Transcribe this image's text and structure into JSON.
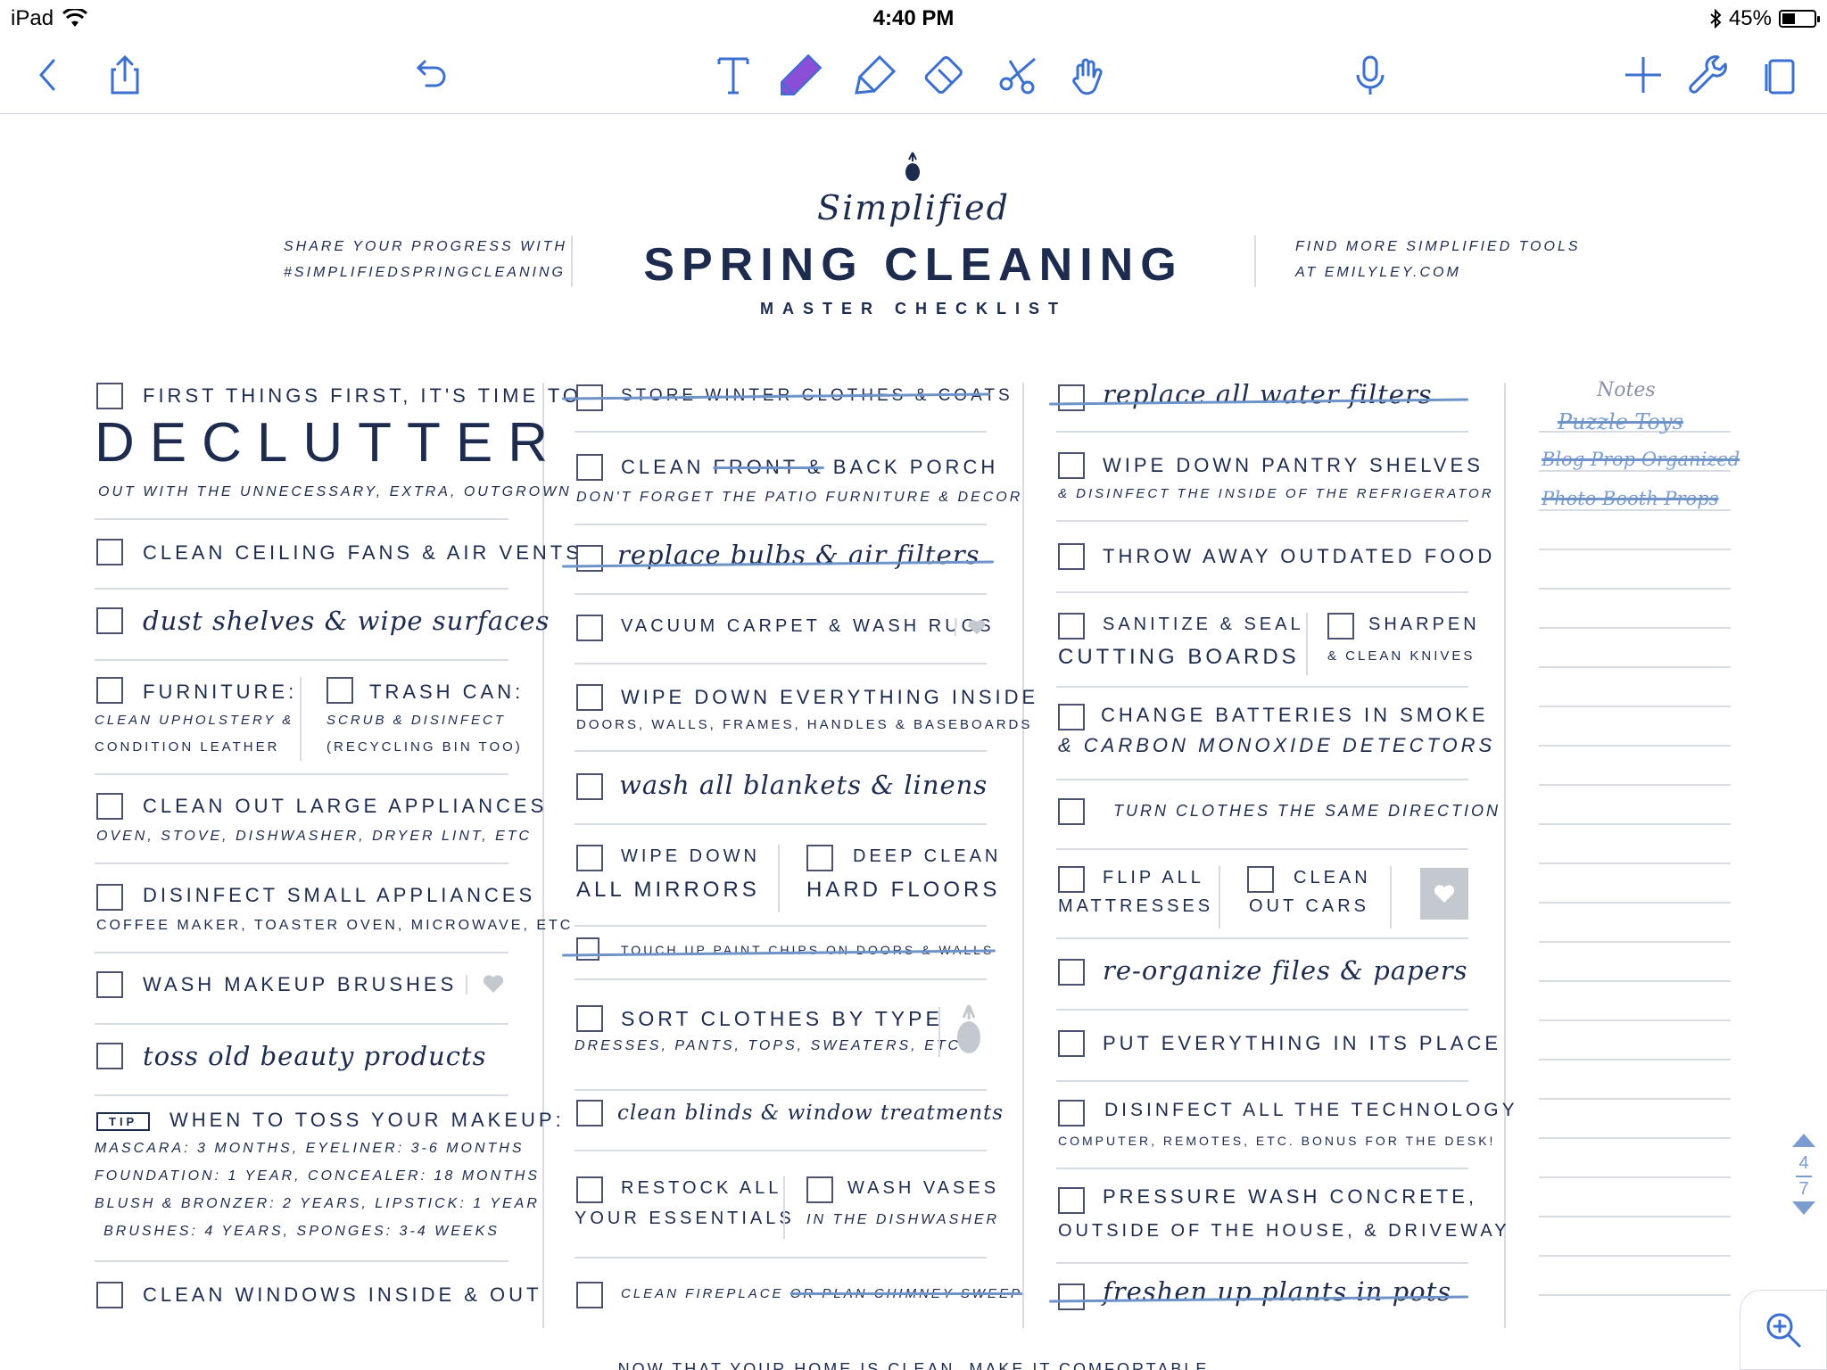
{
  "status": {
    "device": "iPad",
    "time": "4:40 PM",
    "battery": "45%",
    "battery_level": 0.45
  },
  "toolbar": {
    "left_icons": [
      "back-icon",
      "share-icon",
      "undo-icon"
    ],
    "center_icons": [
      "text-tool-icon",
      "pencil-tool-icon",
      "highlighter-tool-icon",
      "eraser-tool-icon",
      "lasso-scissors-icon",
      "hand-tool-icon",
      "microphone-icon"
    ],
    "right_icons": [
      "add-page-icon",
      "wrench-icon",
      "page-view-icon"
    ],
    "selected_tool": "pencil-tool-icon",
    "accent": "#3b6fd1",
    "pencil_color": "#8a4fd6"
  },
  "header": {
    "left_line1": "SHARE YOUR PROGRESS WITH",
    "left_line2": "#SIMPLIFIEDSPRINGCLEANING",
    "script": "Simplified",
    "title": "SPRING CLEANING",
    "subtitle": "MASTER CHECKLIST",
    "right_line1": "FIND MORE SIMPLIFIED TOOLS",
    "right_line2": "AT EMILYLEY.COM"
  },
  "col1": {
    "declutter_pre": "FIRST THINGS FIRST, IT'S TIME TO",
    "declutter_big": "DECLUTTER",
    "declutter_sub": "OUT WITH THE UNNECESSARY, EXTRA, OUTGROWN",
    "fans": "CLEAN CEILING FANS & AIR VENTS",
    "dust": "dust shelves & wipe surfaces",
    "furniture": "FURNITURE:",
    "furniture_sub1": "CLEAN UPHOLSTERY &",
    "furniture_sub2": "CONDITION LEATHER",
    "trash": "TRASH CAN:",
    "trash_sub1": "SCRUB & DISINFECT",
    "trash_sub2": "(RECYCLING BIN TOO)",
    "large_app": "CLEAN OUT LARGE APPLIANCES",
    "large_app_sub": "OVEN, STOVE, DISHWASHER, DRYER LINT, ETC",
    "small_app": "DISINFECT SMALL APPLIANCES",
    "small_app_sub": "COFFEE MAKER, TOASTER OVEN, MICROWAVE, ETC",
    "brushes": "WASH MAKEUP BRUSHES",
    "beauty": "toss old beauty products",
    "tip_badge": "TIP",
    "tip_title": "WHEN TO TOSS YOUR MAKEUP:",
    "tip_lines": [
      "MASCARA: 3 MONTHS, EYELINER: 3-6 MONTHS",
      "FOUNDATION: 1 YEAR, CONCEALER: 18 MONTHS",
      "BLUSH & BRONZER: 2 YEARS, LIPSTICK: 1 YEAR",
      "BRUSHES: 4 YEARS, SPONGES: 3-4 WEEKS"
    ],
    "windows": "CLEAN WINDOWS INSIDE & OUT"
  },
  "col2": {
    "winter": "STORE WINTER CLOTHES & COATS",
    "porch_a": "CLEAN ",
    "porch_b": "FRONT &",
    "porch_c": " BACK PORCH",
    "porch_sub": "DON'T FORGET THE PATIO FURNITURE & DECOR",
    "bulbs": "replace bulbs & air filters",
    "vacuum": "VACUUM CARPET & WASH RUGS",
    "wipe_inside": "WIPE DOWN EVERYTHING INSIDE",
    "wipe_inside_sub": "DOORS, WALLS, FRAMES, HANDLES & BASEBOARDS",
    "blankets": "wash all blankets & linens",
    "mirrors1": "WIPE DOWN",
    "mirrors2": "ALL MIRRORS",
    "floors1": "DEEP CLEAN",
    "floors2": "HARD FLOORS",
    "paint": "TOUCH UP PAINT CHIPS ON DOORS & WALLS",
    "sort": "SORT CLOTHES BY TYPE",
    "sort_sub": "DRESSES, PANTS, TOPS, SWEATERS, ETC",
    "blinds": "clean blinds & window treatments",
    "restock1": "RESTOCK ALL",
    "restock2": "YOUR ESSENTIALS",
    "vases1": "WASH VASES",
    "vases2": "IN THE DISHWASHER",
    "fireplace_a": "CLEAN FIREPLACE ",
    "fireplace_b": "OR PLAN CHIMNEY SWEEP"
  },
  "col3": {
    "water": "replace all water filters",
    "pantry": "WIPE DOWN PANTRY SHELVES",
    "pantry_sub": "& DISINFECT THE INSIDE OF THE REFRIGERATOR",
    "food": "THROW AWAY OUTDATED FOOD",
    "sanitize1": "SANITIZE & SEAL",
    "sanitize2": "CUTTING BOARDS",
    "sharpen1": "SHARPEN",
    "sharpen2": "& CLEAN KNIVES",
    "batteries1": "CHANGE BATTERIES IN SMOKE",
    "batteries2": "& CARBON MONOXIDE DETECTORS",
    "clothes_dir": "TURN CLOTHES THE SAME DIRECTION",
    "flip1": "FLIP ALL",
    "flip2": "MATTRESSES",
    "cars1": "CLEAN",
    "cars2": "OUT CARS",
    "files": "re-organize files & papers",
    "place": "PUT EVERYTHING IN ITS PLACE",
    "tech": "DISINFECT ALL THE TECHNOLOGY",
    "tech_sub": "COMPUTER, REMOTES, ETC. BONUS FOR THE DESK!",
    "pressure1": "PRESSURE WASH CONCRETE,",
    "pressure2": "OUTSIDE OF THE HOUSE, & DRIVEWAY",
    "plants": "freshen up plants in pots"
  },
  "notes": {
    "title": "Notes",
    "entries": [
      "Puzzle Toys",
      "Blog Prop Organized",
      "Photo Booth Props"
    ]
  },
  "footer": {
    "text": "NOW THAT YOUR HOME IS CLEAN, MAKE IT COMFORTABLE"
  },
  "pager": {
    "current": "4",
    "total": "7"
  }
}
